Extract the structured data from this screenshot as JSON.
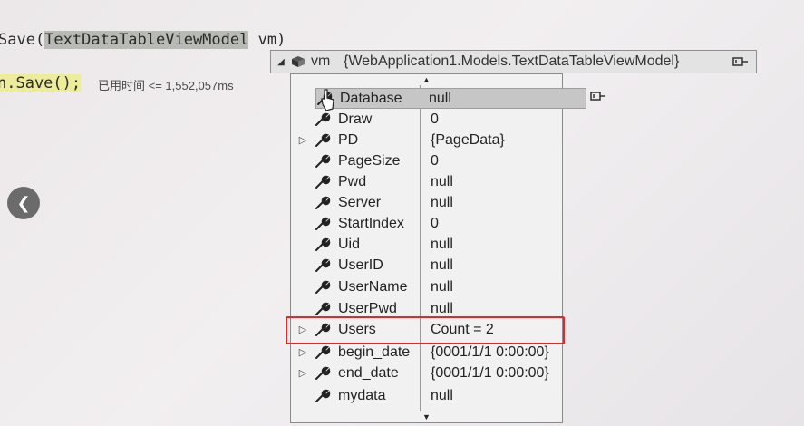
{
  "code": {
    "line1_prefix": "Save(",
    "line1_type": "TextDataTableViewModel",
    "line1_suffix": " vm)",
    "line2_code": "n.Save();",
    "elapsed": "已用时间 <= 1,552,057ms"
  },
  "tooltip": {
    "expander": "◢",
    "var_name": "vm",
    "var_value": "{WebApplication1.Models.TextDataTableViewModel}",
    "members": [
      {
        "name": "Database",
        "value": "null",
        "expandable": false
      },
      {
        "name": "Draw",
        "value": "0",
        "expandable": false
      },
      {
        "name": "PD",
        "value": "{PageData}",
        "expandable": true
      },
      {
        "name": "PageSize",
        "value": "0",
        "expandable": false
      },
      {
        "name": "Pwd",
        "value": "null",
        "expandable": false
      },
      {
        "name": "Server",
        "value": "null",
        "expandable": false
      },
      {
        "name": "StartIndex",
        "value": "0",
        "expandable": false
      },
      {
        "name": "Uid",
        "value": "null",
        "expandable": false
      },
      {
        "name": "UserID",
        "value": "null",
        "expandable": false
      },
      {
        "name": "UserName",
        "value": "null",
        "expandable": false
      },
      {
        "name": "UserPwd",
        "value": "null",
        "expandable": false
      },
      {
        "name": "Users",
        "value": "Count = 2",
        "expandable": true
      },
      {
        "name": "begin_date",
        "value": "{0001/1/1 0:00:00}",
        "expandable": true
      },
      {
        "name": "end_date",
        "value": "{0001/1/1 0:00:00}",
        "expandable": true
      },
      {
        "name": "mydata",
        "value": "null",
        "expandable": false
      }
    ]
  },
  "colors": {
    "highlight_box": "#e02a2a",
    "selected_row": "#c6c6c6"
  }
}
